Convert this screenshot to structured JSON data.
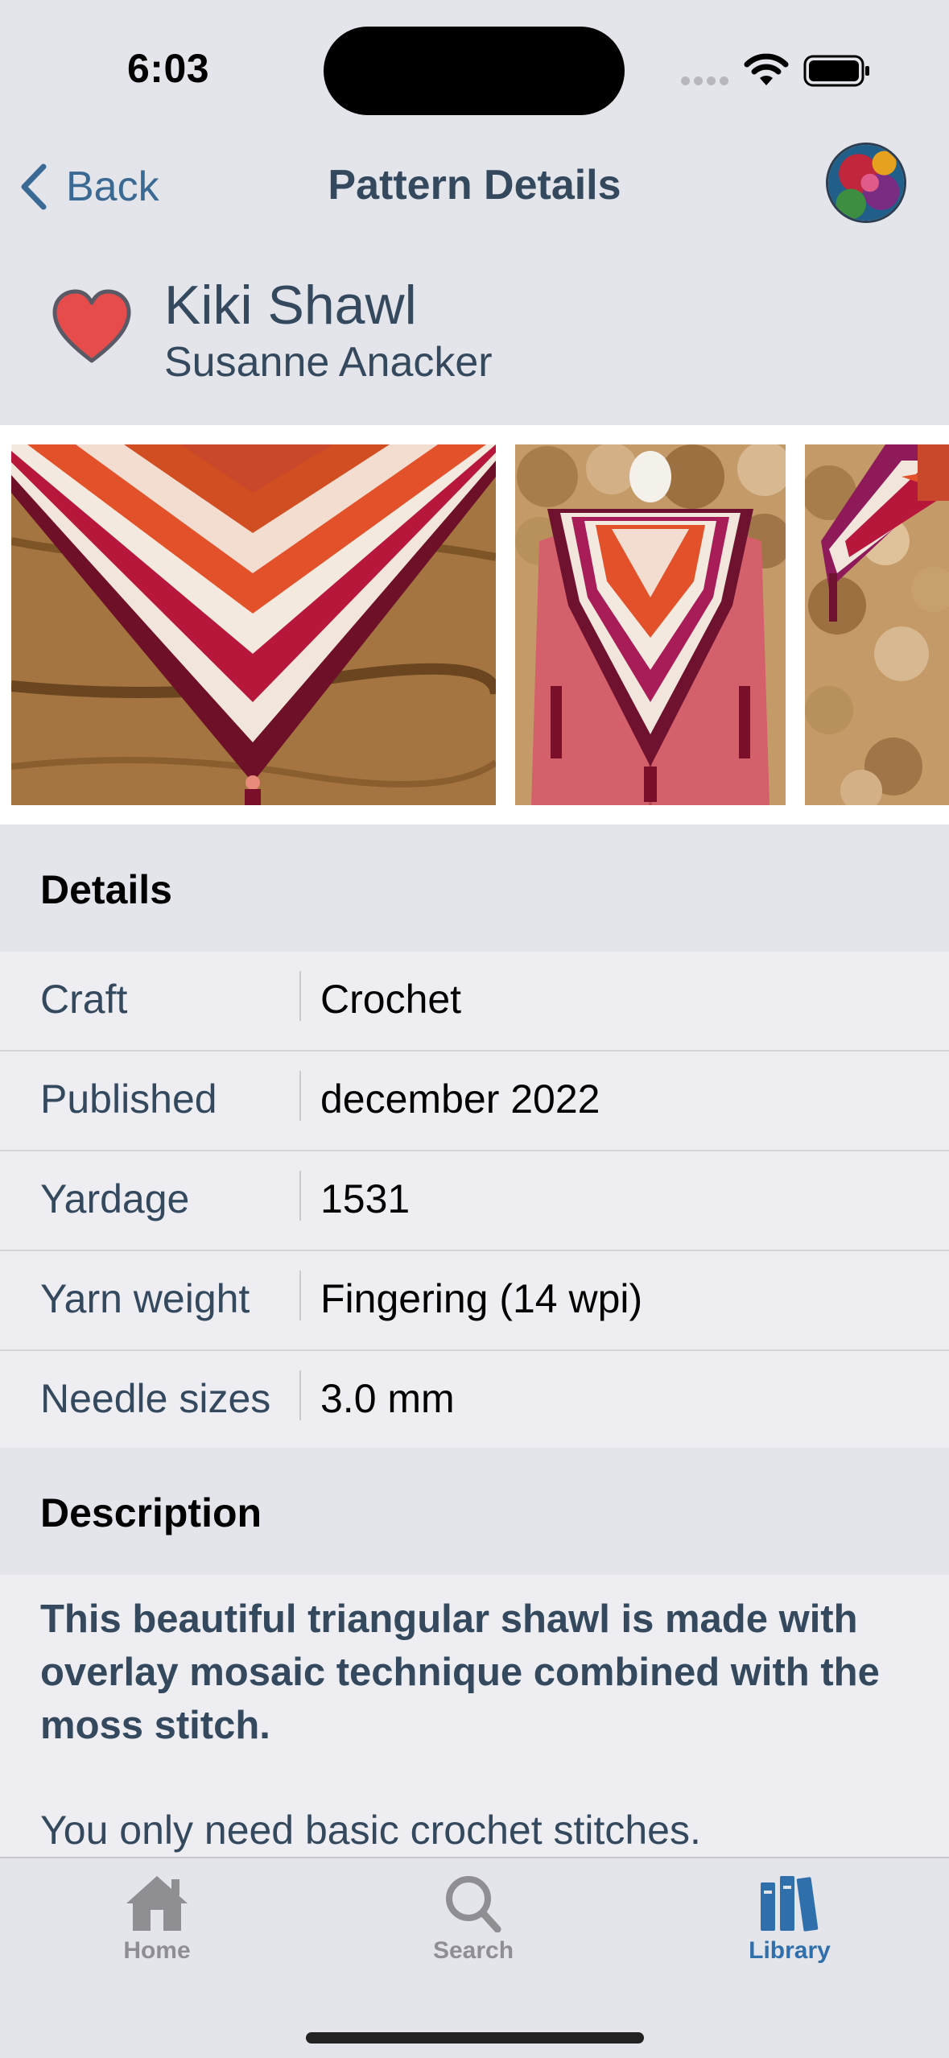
{
  "status_bar": {
    "time": "6:03"
  },
  "nav": {
    "back_label": "Back",
    "title": "Pattern Details"
  },
  "pattern": {
    "name": "Kiki Shawl",
    "designer": "Susanne Anacker",
    "favorited": true
  },
  "details": {
    "heading": "Details",
    "rows": [
      {
        "label": "Craft",
        "value": "Crochet"
      },
      {
        "label": "Published",
        "value": "december 2022"
      },
      {
        "label": "Yardage",
        "value": "1531"
      },
      {
        "label": "Yarn weight",
        "value": "Fingering (14 wpi)"
      },
      {
        "label": "Needle sizes",
        "value": "3.0 mm"
      }
    ]
  },
  "description": {
    "heading": "Description",
    "lead": "This beautiful triangular shawl is made with overlay mosaic technique combined with the moss stitch.",
    "body": "You only need basic crochet stitches."
  },
  "tabbar": {
    "tabs": [
      {
        "label": "Home",
        "icon": "house-icon",
        "active": false
      },
      {
        "label": "Search",
        "icon": "magnifier-icon",
        "active": false
      },
      {
        "label": "Library",
        "icon": "books-icon",
        "active": true
      }
    ]
  },
  "colors": {
    "accent": "#2f6fab",
    "text_primary": "#34495e",
    "heart": "#e74c4c",
    "tab_inactive": "#8e8e93"
  }
}
